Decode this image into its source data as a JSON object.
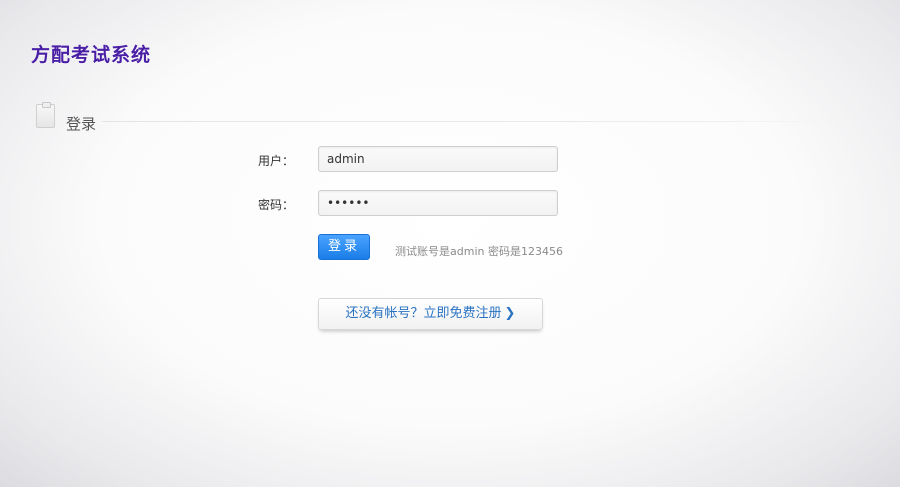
{
  "header": {
    "logo_text": "方配考试系统"
  },
  "section": {
    "title": "登录",
    "icon": "clipboard-icon"
  },
  "form": {
    "username_label": "用户：",
    "username_value": "admin",
    "password_label": "密码：",
    "password_value": "••••••",
    "login_button": "登录",
    "hint": "测试账号是admin 密码是123456"
  },
  "register": {
    "label": "还没有帐号？立即免费注册",
    "icon": "chevron-right-icon"
  },
  "colors": {
    "logo": "#4a1fa6",
    "login_button": "#1a7de8",
    "register_link": "#2a73c2"
  }
}
